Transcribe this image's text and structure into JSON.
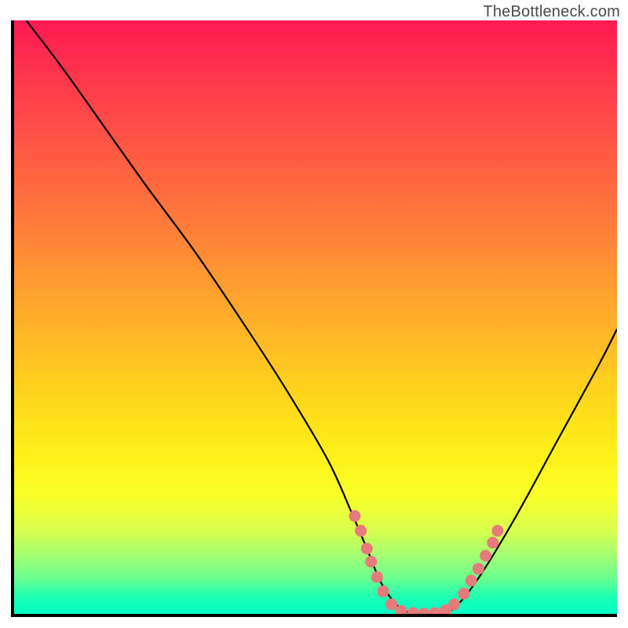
{
  "watermark": "TheBottleneck.com",
  "chart_data": {
    "type": "line",
    "title": "",
    "xlabel": "",
    "ylabel": "",
    "xlim": [
      0,
      100
    ],
    "ylim": [
      0,
      100
    ],
    "grid": false,
    "legend": false,
    "series": [
      {
        "name": "bottleneck-curve",
        "color": "#000000",
        "x": [
          2,
          8,
          15,
          22,
          30,
          38,
          45,
          52,
          56,
          58.5,
          61,
          64,
          67,
          70,
          73,
          77,
          83,
          90,
          97,
          100
        ],
        "y": [
          100,
          92,
          82,
          72,
          61,
          49,
          38,
          26,
          17,
          11,
          5,
          1,
          0,
          0,
          1,
          6,
          16,
          29,
          42,
          48
        ]
      }
    ],
    "markers": {
      "name": "highlight-dots",
      "color": "#e77a7a",
      "points": [
        {
          "x": 56.5,
          "y": 16.5
        },
        {
          "x": 57.5,
          "y": 14
        },
        {
          "x": 58.5,
          "y": 11
        },
        {
          "x": 59.2,
          "y": 8.8
        },
        {
          "x": 60.2,
          "y": 6.2
        },
        {
          "x": 61.2,
          "y": 3.8
        },
        {
          "x": 62.6,
          "y": 1.6
        },
        {
          "x": 64.2,
          "y": 0.5
        },
        {
          "x": 66.2,
          "y": 0.15
        },
        {
          "x": 68.0,
          "y": 0.05
        },
        {
          "x": 69.8,
          "y": 0.15
        },
        {
          "x": 71.6,
          "y": 0.6
        },
        {
          "x": 73.0,
          "y": 1.6
        },
        {
          "x": 74.6,
          "y": 3.4
        },
        {
          "x": 75.8,
          "y": 5.6
        },
        {
          "x": 77.0,
          "y": 7.6
        },
        {
          "x": 78.2,
          "y": 9.8
        },
        {
          "x": 79.4,
          "y": 12.0
        },
        {
          "x": 80.2,
          "y": 14.0
        }
      ]
    },
    "background_gradient": {
      "type": "vertical",
      "stops": [
        {
          "pos": 0.0,
          "color": "#ff1a52"
        },
        {
          "pos": 0.3,
          "color": "#ff6f3e"
        },
        {
          "pos": 0.62,
          "color": "#ffd21d"
        },
        {
          "pos": 0.8,
          "color": "#faff28"
        },
        {
          "pos": 0.94,
          "color": "#6bff8f"
        },
        {
          "pos": 1.0,
          "color": "#00ffc8"
        }
      ]
    }
  }
}
